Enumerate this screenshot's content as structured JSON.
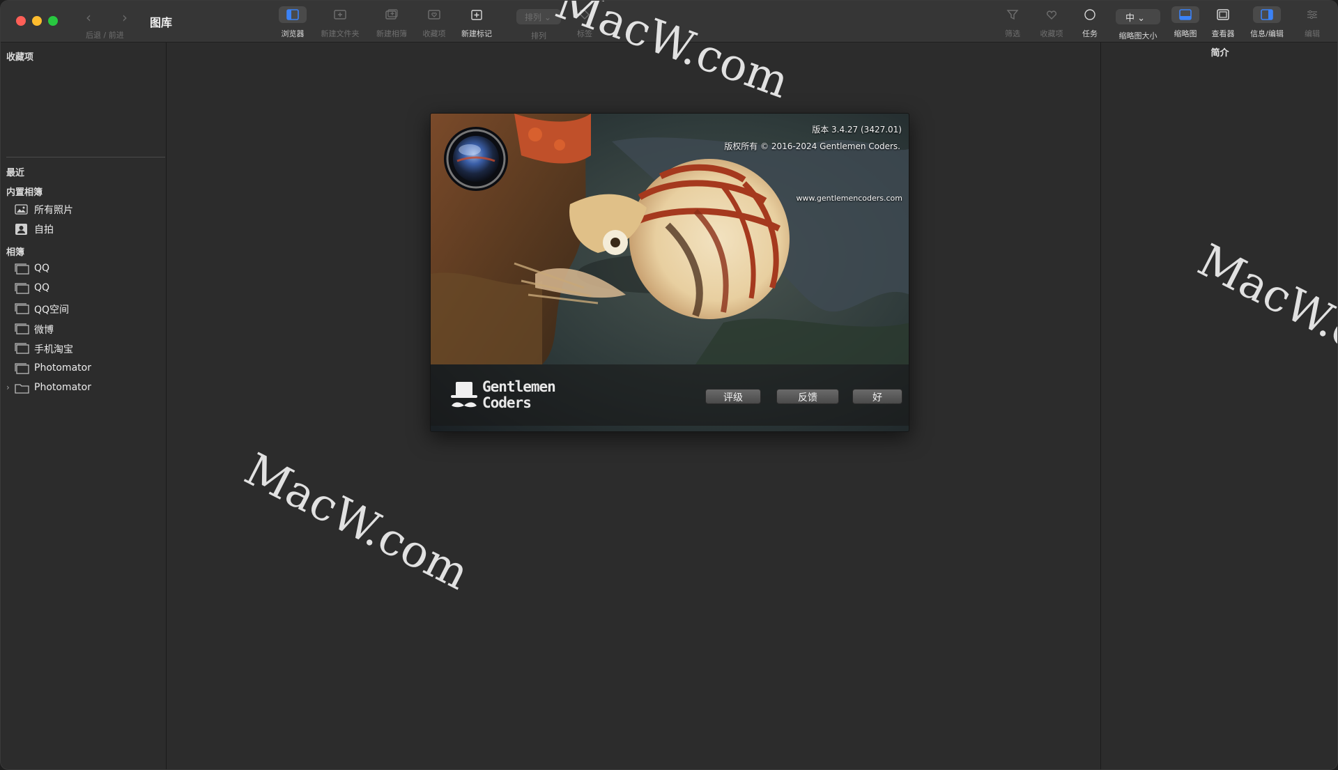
{
  "toolbar": {
    "back_forward_label": "后退 / 前进",
    "title": "图库",
    "tools": [
      {
        "label": "浏览器"
      },
      {
        "label": "新建文件夹"
      },
      {
        "label": "新建相簿"
      },
      {
        "label": "收藏项"
      },
      {
        "label": "新建标记"
      },
      {
        "label": "排列"
      },
      {
        "label": "标签"
      }
    ],
    "sort_pill": "排列",
    "right_tools": [
      {
        "label": "筛选"
      },
      {
        "label": "收藏项"
      },
      {
        "label": "任务"
      },
      {
        "label": "缩略图大小"
      },
      {
        "label": "缩略图"
      },
      {
        "label": "查看器"
      },
      {
        "label": "信息/编辑"
      },
      {
        "label": "编辑"
      }
    ],
    "size_pill": "中"
  },
  "sidebar": {
    "favorites_heading": "收藏项",
    "recent_heading": "最近",
    "builtin_heading": "内置相簿",
    "builtin_items": [
      {
        "label": "所有照片",
        "icon": "photos-icon"
      },
      {
        "label": "自拍",
        "icon": "portrait-icon"
      }
    ],
    "albums_heading": "相簿",
    "album_items": [
      {
        "label": "QQ"
      },
      {
        "label": "QQ"
      },
      {
        "label": "QQ空间"
      },
      {
        "label": "微博"
      },
      {
        "label": "手机淘宝"
      },
      {
        "label": "Photomator"
      },
      {
        "label": "Photomator"
      }
    ]
  },
  "inspector": {
    "title": "简介"
  },
  "about": {
    "version": "版本 3.4.27 (3427.01)",
    "copyright": "版权所有 © 2016-2024 Gentlemen Coders.",
    "url": "www.gentlemencoders.com",
    "brand_line1": "Gentlemen",
    "brand_line2": "Coders",
    "buttons": {
      "rate": "评级",
      "feedback": "反馈",
      "ok": "好"
    }
  },
  "watermark": "MacW.com",
  "colors": {
    "window_bg": "#2c2c2c",
    "toolbar_bg": "#363636",
    "accent": "#3b82f6",
    "close": "#ff5f57",
    "minimize": "#febc2e",
    "zoom": "#28c840"
  }
}
